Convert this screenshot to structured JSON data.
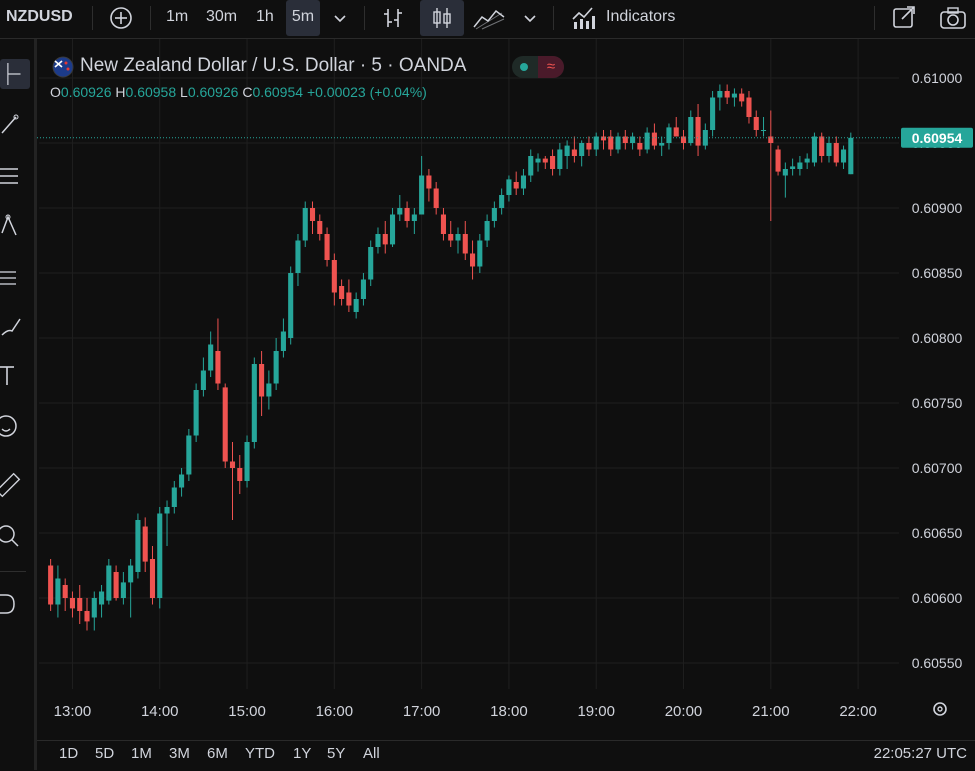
{
  "toolbar": {
    "symbol": "NZDUSD",
    "intervals": [
      "1m",
      "30m",
      "1h",
      "5m"
    ],
    "selected_interval": "5m",
    "indicators_label": "Indicators"
  },
  "legend": {
    "title": "New Zealand Dollar / U.S. Dollar · 5 · OANDA",
    "o_label": "O",
    "o_value": "0.60926",
    "h_label": "H",
    "h_value": "0.60958",
    "l_label": "L",
    "l_value": "0.60926",
    "c_label": "C",
    "c_value": "0.60954",
    "change": "+0.00023 (+0.04%)"
  },
  "price_tag": "0.60954",
  "ranges": [
    "1D",
    "5D",
    "1M",
    "3M",
    "6M",
    "YTD",
    "1Y",
    "5Y",
    "All"
  ],
  "clock": "22:05:27 UTC",
  "colors": {
    "up": "#26a69a",
    "down": "#ef5350",
    "bg": "#0f0f0f",
    "grid": "#1f1f1f"
  },
  "chart_data": {
    "type": "candlestick",
    "title": "New Zealand Dollar / U.S. Dollar · 5 · OANDA",
    "interval": "5m",
    "x_ticks": [
      "13:00",
      "14:00",
      "15:00",
      "16:00",
      "17:00",
      "18:00",
      "19:00",
      "20:00",
      "21:00",
      "22:00"
    ],
    "y_ticks": [
      "0.61000",
      "0.60950",
      "0.60900",
      "0.60850",
      "0.60800",
      "0.60750",
      "0.60700",
      "0.60650",
      "0.60600",
      "0.60550"
    ],
    "ylim": [
      0.6053,
      0.6103
    ],
    "last_price": 0.60954,
    "candles": [
      {
        "o": 0.60625,
        "h": 0.6063,
        "l": 0.6059,
        "c": 0.60595
      },
      {
        "o": 0.60595,
        "h": 0.60625,
        "l": 0.60585,
        "c": 0.60615
      },
      {
        "o": 0.6061,
        "h": 0.60615,
        "l": 0.6059,
        "c": 0.606
      },
      {
        "o": 0.606,
        "h": 0.60605,
        "l": 0.60585,
        "c": 0.60592
      },
      {
        "o": 0.606,
        "h": 0.6061,
        "l": 0.6058,
        "c": 0.6059
      },
      {
        "o": 0.6059,
        "h": 0.606,
        "l": 0.60575,
        "c": 0.60582
      },
      {
        "o": 0.60585,
        "h": 0.60605,
        "l": 0.60575,
        "c": 0.606
      },
      {
        "o": 0.60595,
        "h": 0.6061,
        "l": 0.60585,
        "c": 0.60605
      },
      {
        "o": 0.60598,
        "h": 0.6063,
        "l": 0.60595,
        "c": 0.60625
      },
      {
        "o": 0.6062,
        "h": 0.60625,
        "l": 0.60598,
        "c": 0.606
      },
      {
        "o": 0.606,
        "h": 0.6062,
        "l": 0.60595,
        "c": 0.60612
      },
      {
        "o": 0.60612,
        "h": 0.6063,
        "l": 0.60585,
        "c": 0.60625
      },
      {
        "o": 0.6062,
        "h": 0.60665,
        "l": 0.60615,
        "c": 0.6066
      },
      {
        "o": 0.60655,
        "h": 0.60662,
        "l": 0.6062,
        "c": 0.60628
      },
      {
        "o": 0.6063,
        "h": 0.6064,
        "l": 0.60595,
        "c": 0.606
      },
      {
        "o": 0.606,
        "h": 0.6067,
        "l": 0.60592,
        "c": 0.60665
      },
      {
        "o": 0.60665,
        "h": 0.60675,
        "l": 0.6064,
        "c": 0.6067
      },
      {
        "o": 0.6067,
        "h": 0.6069,
        "l": 0.60665,
        "c": 0.60685
      },
      {
        "o": 0.60685,
        "h": 0.607,
        "l": 0.60678,
        "c": 0.60695
      },
      {
        "o": 0.60695,
        "h": 0.6073,
        "l": 0.6069,
        "c": 0.60725
      },
      {
        "o": 0.60725,
        "h": 0.60765,
        "l": 0.6072,
        "c": 0.6076
      },
      {
        "o": 0.6076,
        "h": 0.60785,
        "l": 0.60755,
        "c": 0.60775
      },
      {
        "o": 0.60775,
        "h": 0.60805,
        "l": 0.6077,
        "c": 0.60795
      },
      {
        "o": 0.6079,
        "h": 0.60815,
        "l": 0.6076,
        "c": 0.60765
      },
      {
        "o": 0.60762,
        "h": 0.60765,
        "l": 0.607,
        "c": 0.60705
      },
      {
        "o": 0.60705,
        "h": 0.6072,
        "l": 0.6066,
        "c": 0.607
      },
      {
        "o": 0.607,
        "h": 0.6071,
        "l": 0.6068,
        "c": 0.6069
      },
      {
        "o": 0.6069,
        "h": 0.60725,
        "l": 0.60685,
        "c": 0.6072
      },
      {
        "o": 0.6072,
        "h": 0.60785,
        "l": 0.60715,
        "c": 0.6078
      },
      {
        "o": 0.6078,
        "h": 0.6079,
        "l": 0.6074,
        "c": 0.60755
      },
      {
        "o": 0.60755,
        "h": 0.60775,
        "l": 0.60745,
        "c": 0.60765
      },
      {
        "o": 0.60765,
        "h": 0.608,
        "l": 0.6076,
        "c": 0.6079
      },
      {
        "o": 0.6079,
        "h": 0.60815,
        "l": 0.60785,
        "c": 0.60805
      },
      {
        "o": 0.608,
        "h": 0.60855,
        "l": 0.60795,
        "c": 0.6085
      },
      {
        "o": 0.6085,
        "h": 0.6088,
        "l": 0.6084,
        "c": 0.60875
      },
      {
        "o": 0.60875,
        "h": 0.60905,
        "l": 0.6087,
        "c": 0.609
      },
      {
        "o": 0.609,
        "h": 0.60905,
        "l": 0.6088,
        "c": 0.6089
      },
      {
        "o": 0.6089,
        "h": 0.60895,
        "l": 0.60875,
        "c": 0.6088
      },
      {
        "o": 0.6088,
        "h": 0.60885,
        "l": 0.60855,
        "c": 0.6086
      },
      {
        "o": 0.6086,
        "h": 0.60865,
        "l": 0.60825,
        "c": 0.60835
      },
      {
        "o": 0.6084,
        "h": 0.60845,
        "l": 0.60825,
        "c": 0.6083
      },
      {
        "o": 0.60835,
        "h": 0.60845,
        "l": 0.6082,
        "c": 0.60825
      },
      {
        "o": 0.6082,
        "h": 0.60835,
        "l": 0.60815,
        "c": 0.6083
      },
      {
        "o": 0.6083,
        "h": 0.6085,
        "l": 0.60825,
        "c": 0.60845
      },
      {
        "o": 0.60845,
        "h": 0.60875,
        "l": 0.6084,
        "c": 0.6087
      },
      {
        "o": 0.6087,
        "h": 0.60885,
        "l": 0.60865,
        "c": 0.6088
      },
      {
        "o": 0.6088,
        "h": 0.6089,
        "l": 0.60865,
        "c": 0.60872
      },
      {
        "o": 0.60872,
        "h": 0.609,
        "l": 0.6087,
        "c": 0.60895
      },
      {
        "o": 0.60895,
        "h": 0.6091,
        "l": 0.6089,
        "c": 0.609
      },
      {
        "o": 0.609,
        "h": 0.60905,
        "l": 0.60885,
        "c": 0.6089
      },
      {
        "o": 0.6089,
        "h": 0.609,
        "l": 0.6088,
        "c": 0.60895
      },
      {
        "o": 0.60895,
        "h": 0.6094,
        "l": 0.60895,
        "c": 0.60925
      },
      {
        "o": 0.60925,
        "h": 0.6093,
        "l": 0.60905,
        "c": 0.60915
      },
      {
        "o": 0.60915,
        "h": 0.6092,
        "l": 0.60895,
        "c": 0.609
      },
      {
        "o": 0.60895,
        "h": 0.609,
        "l": 0.60875,
        "c": 0.6088
      },
      {
        "o": 0.6088,
        "h": 0.6089,
        "l": 0.6087,
        "c": 0.60875
      },
      {
        "o": 0.60875,
        "h": 0.60885,
        "l": 0.60865,
        "c": 0.6088
      },
      {
        "o": 0.6088,
        "h": 0.6089,
        "l": 0.6086,
        "c": 0.60865
      },
      {
        "o": 0.60865,
        "h": 0.60875,
        "l": 0.60845,
        "c": 0.60855
      },
      {
        "o": 0.60855,
        "h": 0.6088,
        "l": 0.6085,
        "c": 0.60875
      },
      {
        "o": 0.60875,
        "h": 0.60895,
        "l": 0.6087,
        "c": 0.6089
      },
      {
        "o": 0.6089,
        "h": 0.60905,
        "l": 0.60885,
        "c": 0.609
      },
      {
        "o": 0.609,
        "h": 0.60915,
        "l": 0.60895,
        "c": 0.6091
      },
      {
        "o": 0.6091,
        "h": 0.60925,
        "l": 0.60905,
        "c": 0.60922
      },
      {
        "o": 0.6092,
        "h": 0.60928,
        "l": 0.6091,
        "c": 0.60915
      },
      {
        "o": 0.60915,
        "h": 0.6093,
        "l": 0.6091,
        "c": 0.60925
      },
      {
        "o": 0.60925,
        "h": 0.60945,
        "l": 0.6092,
        "c": 0.6094
      },
      {
        "o": 0.60935,
        "h": 0.60942,
        "l": 0.60928,
        "c": 0.60938
      },
      {
        "o": 0.60938,
        "h": 0.6094,
        "l": 0.6093,
        "c": 0.60935
      },
      {
        "o": 0.6094,
        "h": 0.60945,
        "l": 0.60925,
        "c": 0.6093
      },
      {
        "o": 0.6093,
        "h": 0.6095,
        "l": 0.60925,
        "c": 0.60945
      },
      {
        "o": 0.6094,
        "h": 0.60952,
        "l": 0.6093,
        "c": 0.60948
      },
      {
        "o": 0.60945,
        "h": 0.60955,
        "l": 0.60935,
        "c": 0.6094
      },
      {
        "o": 0.6094,
        "h": 0.60952,
        "l": 0.60932,
        "c": 0.6095
      },
      {
        "o": 0.6095,
        "h": 0.60955,
        "l": 0.6094,
        "c": 0.60945
      },
      {
        "o": 0.60945,
        "h": 0.60958,
        "l": 0.6094,
        "c": 0.60955
      },
      {
        "o": 0.60955,
        "h": 0.6096,
        "l": 0.60945,
        "c": 0.60952
      },
      {
        "o": 0.60955,
        "h": 0.6096,
        "l": 0.6094,
        "c": 0.60945
      },
      {
        "o": 0.60945,
        "h": 0.60958,
        "l": 0.60942,
        "c": 0.60955
      },
      {
        "o": 0.60955,
        "h": 0.6096,
        "l": 0.60945,
        "c": 0.6095
      },
      {
        "o": 0.6095,
        "h": 0.60958,
        "l": 0.60945,
        "c": 0.60955
      },
      {
        "o": 0.6095,
        "h": 0.60955,
        "l": 0.6094,
        "c": 0.60945
      },
      {
        "o": 0.60945,
        "h": 0.60962,
        "l": 0.60942,
        "c": 0.60958
      },
      {
        "o": 0.60958,
        "h": 0.60965,
        "l": 0.60945,
        "c": 0.60948
      },
      {
        "o": 0.60948,
        "h": 0.60955,
        "l": 0.6094,
        "c": 0.6095
      },
      {
        "o": 0.6095,
        "h": 0.60965,
        "l": 0.60945,
        "c": 0.60962
      },
      {
        "o": 0.60962,
        "h": 0.6097,
        "l": 0.60955,
        "c": 0.60955
      },
      {
        "o": 0.60955,
        "h": 0.6096,
        "l": 0.60945,
        "c": 0.6095
      },
      {
        "o": 0.6095,
        "h": 0.60975,
        "l": 0.60948,
        "c": 0.6097
      },
      {
        "o": 0.6097,
        "h": 0.6098,
        "l": 0.6094,
        "c": 0.60948
      },
      {
        "o": 0.60948,
        "h": 0.60965,
        "l": 0.60945,
        "c": 0.6096
      },
      {
        "o": 0.6096,
        "h": 0.6099,
        "l": 0.60955,
        "c": 0.60985
      },
      {
        "o": 0.60985,
        "h": 0.60995,
        "l": 0.60975,
        "c": 0.6099
      },
      {
        "o": 0.6099,
        "h": 0.60995,
        "l": 0.6098,
        "c": 0.60985
      },
      {
        "o": 0.60985,
        "h": 0.60992,
        "l": 0.60978,
        "c": 0.60988
      },
      {
        "o": 0.60988,
        "h": 0.60992,
        "l": 0.60978,
        "c": 0.60982
      },
      {
        "o": 0.60985,
        "h": 0.6099,
        "l": 0.60965,
        "c": 0.6097
      },
      {
        "o": 0.6097,
        "h": 0.60975,
        "l": 0.60955,
        "c": 0.6096
      },
      {
        "o": 0.6096,
        "h": 0.6097,
        "l": 0.60955,
        "c": 0.6096
      },
      {
        "o": 0.60955,
        "h": 0.60975,
        "l": 0.6089,
        "c": 0.6095
      },
      {
        "o": 0.60945,
        "h": 0.60948,
        "l": 0.60925,
        "c": 0.60928
      },
      {
        "o": 0.60925,
        "h": 0.60935,
        "l": 0.60908,
        "c": 0.6093
      },
      {
        "o": 0.6093,
        "h": 0.60938,
        "l": 0.60925,
        "c": 0.60932
      },
      {
        "o": 0.6093,
        "h": 0.6094,
        "l": 0.60925,
        "c": 0.60935
      },
      {
        "o": 0.60935,
        "h": 0.60942,
        "l": 0.6093,
        "c": 0.60938
      },
      {
        "o": 0.60935,
        "h": 0.60958,
        "l": 0.60932,
        "c": 0.60955
      },
      {
        "o": 0.60955,
        "h": 0.60958,
        "l": 0.60935,
        "c": 0.6094
      },
      {
        "o": 0.6094,
        "h": 0.60955,
        "l": 0.60935,
        "c": 0.6095
      },
      {
        "o": 0.6095,
        "h": 0.60955,
        "l": 0.60932,
        "c": 0.60935
      },
      {
        "o": 0.60935,
        "h": 0.60948,
        "l": 0.6093,
        "c": 0.60945
      },
      {
        "o": 0.60926,
        "h": 0.60958,
        "l": 0.60926,
        "c": 0.60954
      }
    ]
  }
}
